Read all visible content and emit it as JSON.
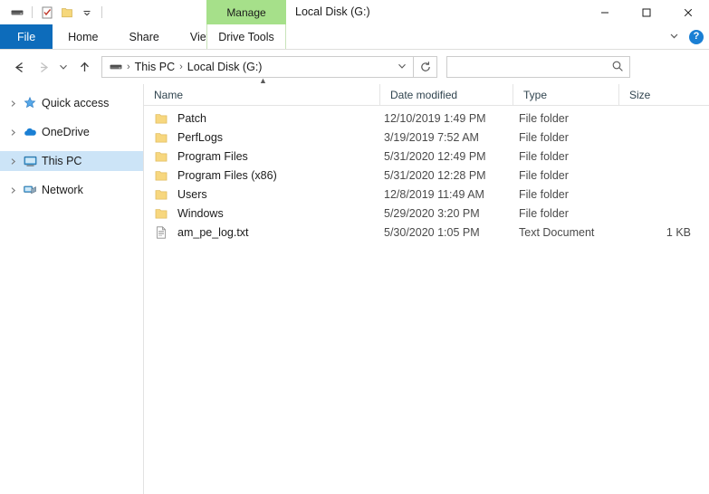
{
  "window": {
    "title": "Local Disk (G:)",
    "contextual_tab_header": "Manage",
    "minimize_icon": "minimize-icon",
    "maximize_icon": "maximize-icon",
    "close_icon": "close-icon"
  },
  "quick_access_toolbar": {
    "items": [
      {
        "name": "drive-icon",
        "label": ""
      },
      {
        "name": "properties-icon",
        "label": ""
      },
      {
        "name": "new-folder-icon",
        "label": ""
      },
      {
        "name": "customize-chevron-icon",
        "label": ""
      }
    ]
  },
  "ribbon": {
    "tabs": [
      {
        "label": "File",
        "selected": true,
        "style": "file"
      },
      {
        "label": "Home",
        "selected": false,
        "style": "normal"
      },
      {
        "label": "Share",
        "selected": false,
        "style": "normal"
      },
      {
        "label": "View",
        "selected": false,
        "style": "normal"
      }
    ],
    "contextual_tab": {
      "label": "Drive Tools"
    },
    "collapse_icon": "chevron-down-icon",
    "help_label": "?"
  },
  "address_bar": {
    "back_icon": "back-arrow-icon",
    "forward_icon": "forward-arrow-icon",
    "recent_icon": "chevron-down-icon",
    "up_icon": "up-arrow-icon",
    "drive_icon": "drive-icon",
    "breadcrumbs": [
      {
        "label": "This PC"
      },
      {
        "label": "Local Disk (G:)"
      }
    ],
    "separator": "›",
    "dropdown_icon": "chevron-down-icon",
    "refresh_icon": "refresh-icon"
  },
  "search": {
    "value": "",
    "placeholder": "",
    "icon": "search-icon"
  },
  "sidebar": {
    "items": [
      {
        "label": "Quick access",
        "icon": "star-icon",
        "selected": false,
        "expand_icon": "chevron-right-icon"
      },
      {
        "label": "OneDrive",
        "icon": "cloud-icon",
        "selected": false,
        "expand_icon": "chevron-right-icon"
      },
      {
        "label": "This PC",
        "icon": "monitor-icon",
        "selected": true,
        "expand_icon": "chevron-right-icon"
      },
      {
        "label": "Network",
        "icon": "network-icon",
        "selected": false,
        "expand_icon": "chevron-right-icon"
      }
    ]
  },
  "file_list": {
    "columns": [
      {
        "label": "Name",
        "sorted": true,
        "sort_icon": "caret-up-icon"
      },
      {
        "label": "Date modified",
        "sorted": false
      },
      {
        "label": "Type",
        "sorted": false
      },
      {
        "label": "Size",
        "sorted": false
      }
    ],
    "rows": [
      {
        "name": "Patch",
        "date": "12/10/2019 1:49 PM",
        "type": "File folder",
        "size": "",
        "icon": "folder-icon"
      },
      {
        "name": "PerfLogs",
        "date": "3/19/2019 7:52 AM",
        "type": "File folder",
        "size": "",
        "icon": "folder-icon"
      },
      {
        "name": "Program Files",
        "date": "5/31/2020 12:49 PM",
        "type": "File folder",
        "size": "",
        "icon": "folder-icon"
      },
      {
        "name": "Program Files (x86)",
        "date": "5/31/2020 12:28 PM",
        "type": "File folder",
        "size": "",
        "icon": "folder-icon"
      },
      {
        "name": "Users",
        "date": "12/8/2019 11:49 AM",
        "type": "File folder",
        "size": "",
        "icon": "folder-icon"
      },
      {
        "name": "Windows",
        "date": "5/29/2020 3:20 PM",
        "type": "File folder",
        "size": "",
        "icon": "folder-icon"
      },
      {
        "name": "am_pe_log.txt",
        "date": "5/30/2020 1:05 PM",
        "type": "Text Document",
        "size": "1 KB",
        "icon": "text-file-icon"
      }
    ]
  },
  "colors": {
    "file_tab_blue": "#0d6cbb",
    "contextual_green": "#a6e08a",
    "selection_blue": "#cce4f7",
    "folder_yellow": "#f7d77f",
    "help_blue": "#1a7fd4"
  }
}
